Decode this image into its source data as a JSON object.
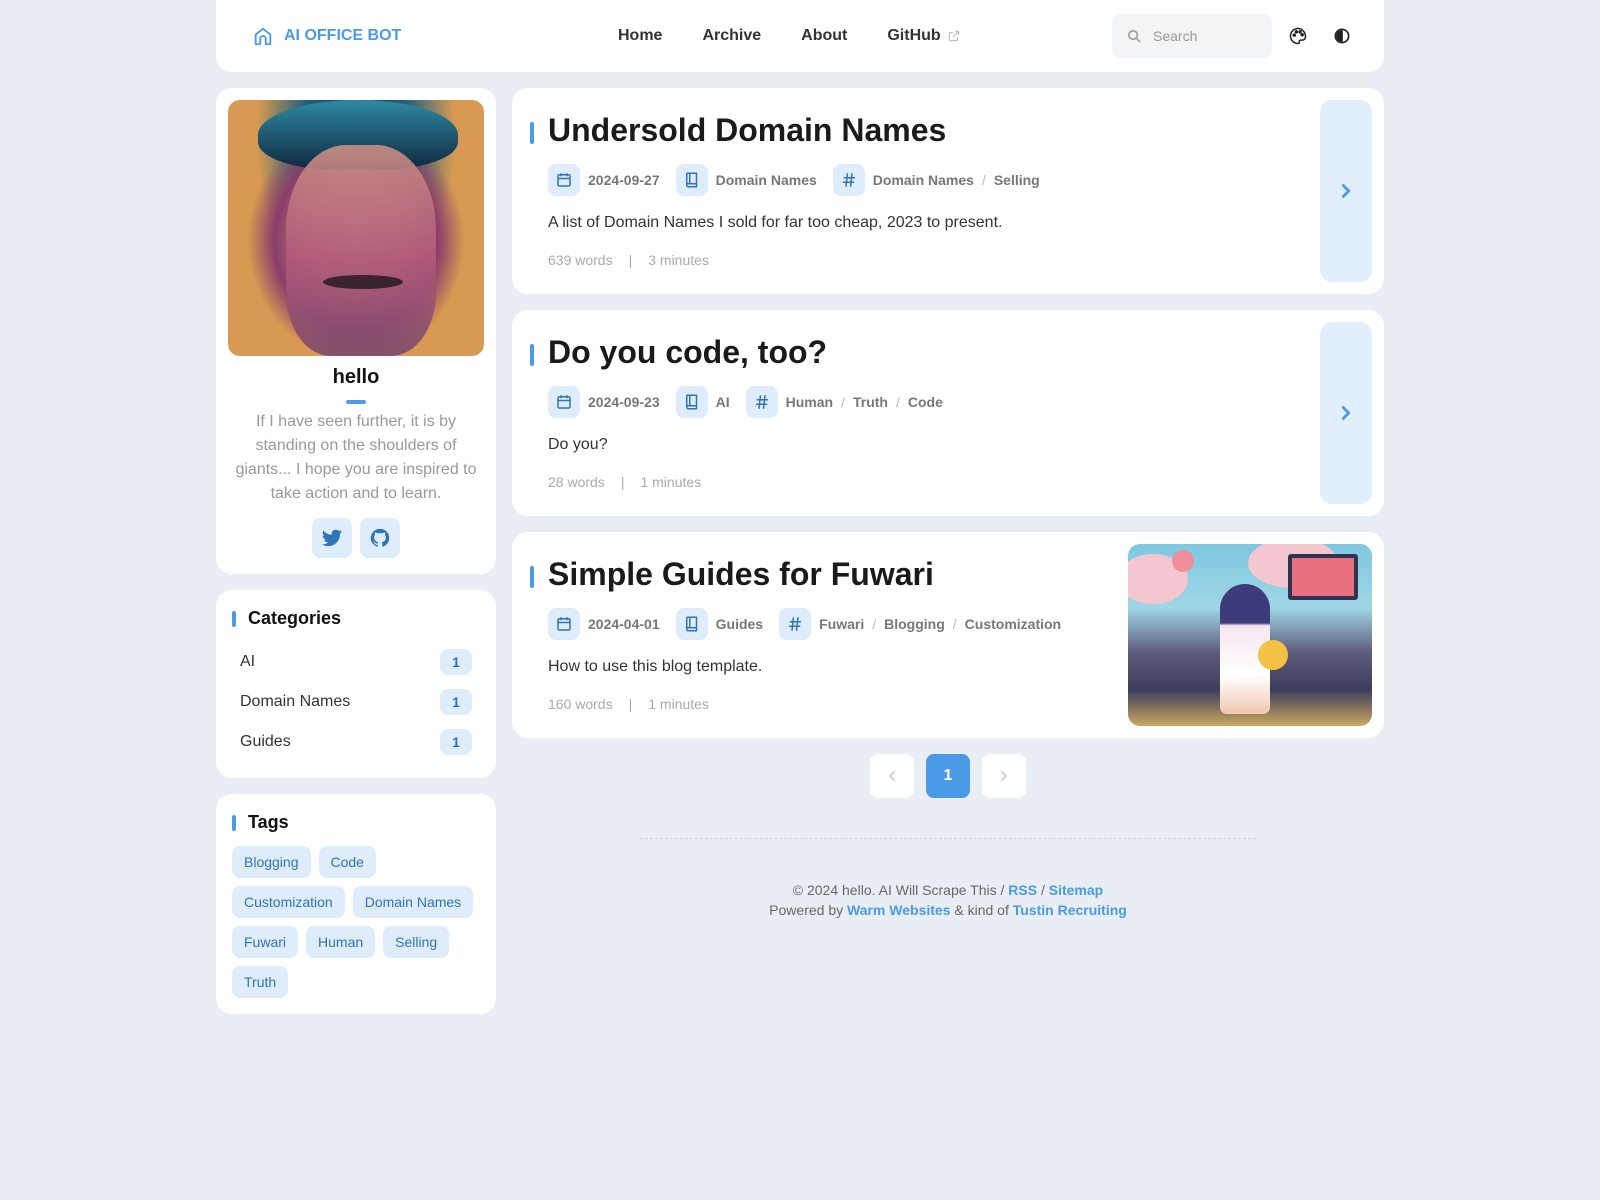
{
  "navbar": {
    "brand": "AI OFFICE BOT",
    "links": [
      {
        "label": "Home"
      },
      {
        "label": "Archive"
      },
      {
        "label": "About"
      },
      {
        "label": "GitHub",
        "external": true
      }
    ],
    "search": {
      "placeholder": "Search",
      "value": ""
    },
    "icons": [
      "palette-icon",
      "theme-toggle-icon"
    ]
  },
  "profile": {
    "name": "hello",
    "bio": "If I have seen further, it is by standing on the shoulders of giants... I hope you are inspired to take action and to learn.",
    "socials": [
      {
        "name": "twitter-icon"
      },
      {
        "name": "github-icon"
      }
    ]
  },
  "categories": {
    "title": "Categories",
    "items": [
      {
        "label": "AI",
        "count": "1"
      },
      {
        "label": "Domain Names",
        "count": "1"
      },
      {
        "label": "Guides",
        "count": "1"
      }
    ]
  },
  "tags": {
    "title": "Tags",
    "items": [
      "Blogging",
      "Code",
      "Customization",
      "Domain Names",
      "Fuwari",
      "Human",
      "Selling",
      "Truth"
    ]
  },
  "posts": [
    {
      "title": "Undersold Domain Names",
      "date": "2024-09-27",
      "category": "Domain Names",
      "tags": [
        "Domain Names",
        "Selling"
      ],
      "description": "A list of Domain Names I sold for far too cheap, 2023 to present.",
      "words": "639 words",
      "reading_time": "3 minutes"
    },
    {
      "title": "Do you code, too?",
      "date": "2024-09-23",
      "category": "AI",
      "tags": [
        "Human",
        "Truth",
        "Code"
      ],
      "description": "Do you?",
      "words": "28 words",
      "reading_time": "1 minutes"
    },
    {
      "title": "Simple Guides for Fuwari",
      "date": "2024-04-01",
      "category": "Guides",
      "tags": [
        "Fuwari",
        "Blogging",
        "Customization"
      ],
      "description": "How to use this blog template.",
      "words": "160 words",
      "reading_time": "1 minutes"
    }
  ],
  "pagination": {
    "current": "1",
    "separator": "|"
  },
  "footer": {
    "line1_prefix": "© 2024 hello. AI Will Scrape This / ",
    "rss": "RSS",
    "slash": " / ",
    "sitemap": "Sitemap",
    "line2_prefix": "Powered by ",
    "powered_by": "Warm Websites",
    "line2_middle": " & kind of ",
    "kind_of": "Tustin Recruiting"
  },
  "colors": {
    "accent": "#4a9ae6",
    "accent_bg": "#deecfb",
    "page_bg": "#e9eef5"
  }
}
